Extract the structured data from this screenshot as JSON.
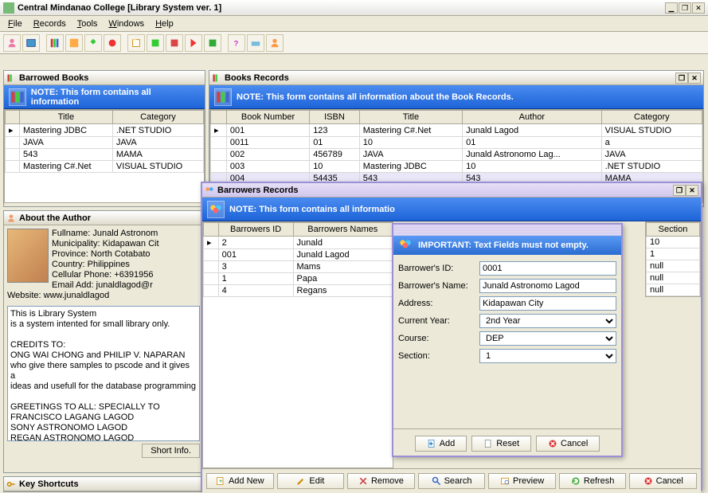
{
  "window": {
    "title": "Central Mindanao College [Library System ver. 1]"
  },
  "menu": {
    "file": "File",
    "records": "Records",
    "tools": "Tools",
    "windows": "Windows",
    "help": "Help"
  },
  "panels": {
    "borrowed": {
      "title": "Barrowed Books",
      "note": "NOTE: This form contains all information"
    },
    "books": {
      "title": "Books Records",
      "note": "NOTE: This form contains all information about the Book Records."
    },
    "about": {
      "title": "About the Author"
    },
    "keys": {
      "title": "Key Shortcuts"
    },
    "borrowers": {
      "title": "Barrowers Records",
      "note": "NOTE: This form contains all informatio"
    }
  },
  "borrowed_cols": [
    "Title",
    "Category"
  ],
  "borrowed_rows": [
    [
      "Mastering JDBC",
      ".NET STUDIO"
    ],
    [
      "JAVA",
      "JAVA"
    ],
    [
      "543",
      "MAMA"
    ],
    [
      "Mastering C#.Net",
      "VISUAL STUDIO"
    ]
  ],
  "books_cols": [
    "Book Number",
    "ISBN",
    "Title",
    "Author",
    "Category"
  ],
  "books_rows": [
    [
      "001",
      "123",
      "Mastering C#.Net",
      "Junald Lagod",
      "VISUAL STUDIO"
    ],
    [
      "0011",
      "01",
      "10",
      "01",
      "a"
    ],
    [
      "002",
      "456789",
      "JAVA",
      "Junald Astronomo Lag...",
      "JAVA"
    ],
    [
      "003",
      "10",
      "Mastering JDBC",
      "10",
      ".NET STUDIO"
    ],
    [
      "004",
      "54435",
      "543",
      "543",
      "MAMA"
    ]
  ],
  "books_extra_col": "Section",
  "books_extra": [
    "10",
    "1",
    "null",
    "null",
    "null"
  ],
  "borrowers_cols": [
    "Barrowers ID",
    "Barrowers Names"
  ],
  "borrowers_rows": [
    [
      "2",
      "Junald"
    ],
    [
      "001",
      "Junald Lagod"
    ],
    [
      "3",
      "Mams"
    ],
    [
      "1",
      "Papa"
    ],
    [
      "4",
      "Regans"
    ]
  ],
  "author": {
    "line1": "Fullname: Junald Astronom",
    "line2": "Municipality: Kidapawan Cit",
    "line3": "Province: North Cotabato",
    "line4": "Country: Philippines",
    "line5": "Cellular Phone: +6391956",
    "line6": "Email Add: junaldlagod@r",
    "line7": "Website: www.junaldlagod",
    "body": "This is Library System\nis a system intented for small library only.\n\nCREDITS TO:\nONG WAI CHONG and PHILIP V. NAPARAN\nwho give there samples to pscode and it gives a\nideas and usefull for the database programming\n\nGREETINGS TO ALL: SPECIALLY TO\nFRANCISCO LAGANG LAGOD\nSONY ASTRONOMO LAGOD\nREGAN ASTRONOMO LAGOD",
    "shortbtn": "Short Info."
  },
  "dialog": {
    "important": "IMPORTANT: Text Fields must not empty.",
    "labels": {
      "id": "Barrower's ID:",
      "name": "Barrower's Name:",
      "addr": "Address:",
      "year": "Current Year:",
      "course": "Course:",
      "section": "Section:"
    },
    "values": {
      "id": "0001",
      "name": "Junald Astronomo Lagod",
      "addr": "Kidapawan City",
      "year": "2nd Year",
      "course": "DEP",
      "section": "1"
    },
    "btns": {
      "add": "Add",
      "reset": "Reset",
      "cancel": "Cancel"
    }
  },
  "borrbtns": {
    "addnew": "Add New",
    "edit": "Edit",
    "remove": "Remove",
    "search": "Search",
    "preview": "Preview",
    "refresh": "Refresh",
    "cancel": "Cancel"
  }
}
